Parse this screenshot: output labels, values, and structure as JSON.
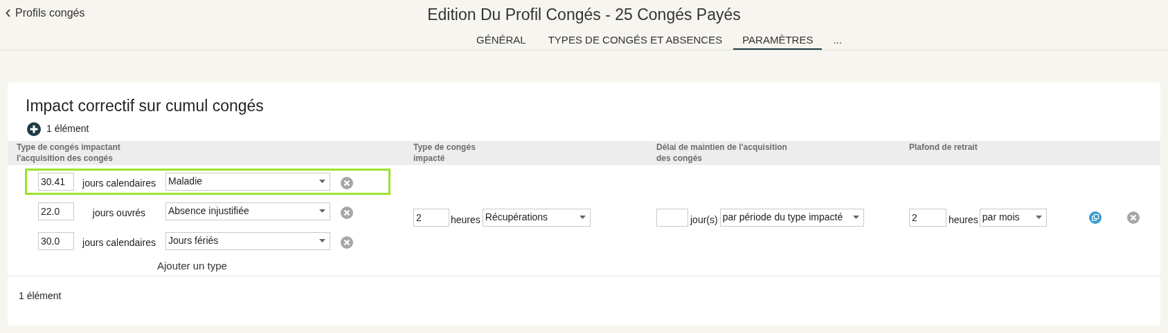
{
  "back_link": {
    "label": "Profils congés"
  },
  "page_title": "Edition Du Profil Congés - 25 Congés Payés",
  "tabs": [
    {
      "label": "GÉNÉRAL",
      "selected": false
    },
    {
      "label": "TYPES DE CONGÉS ET ABSENCES",
      "selected": false
    },
    {
      "label": "PARAMÈTRES",
      "selected": true
    },
    {
      "label": "...",
      "selected": false
    }
  ],
  "section": {
    "title": "Impact correctif sur cumul congés",
    "count": "1 élément",
    "columns": [
      "Type de congés impactant l'acquisition des congés",
      "Type de congés impacté",
      "Délai de maintien de l'acquisition des congés",
      "Plafond de retrait"
    ],
    "row": {
      "impacting_types": [
        {
          "value": "30.41",
          "unit": "jours calendaires",
          "type": "Maladie",
          "highlighted": true
        },
        {
          "value": "22.0",
          "unit": "jours ouvrés",
          "type": "Absence injustifiée",
          "highlighted": false
        },
        {
          "value": "30.0",
          "unit": "jours calendaires",
          "type": "Jours fériés",
          "highlighted": false
        }
      ],
      "add_type": "Ajouter un type",
      "impacted": {
        "value": "2",
        "unit": "heures",
        "type": "Récupérations"
      },
      "delay": {
        "unit": "jour(s)",
        "period": "par période du type impacté"
      },
      "ceiling": {
        "value": "2",
        "unit": "heures",
        "period": "par mois"
      }
    },
    "footer_count": "1 élément"
  }
}
